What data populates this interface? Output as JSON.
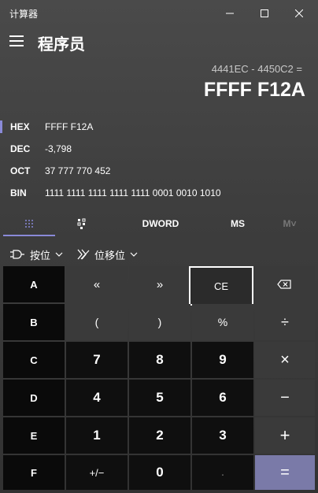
{
  "window": {
    "title": "计算器"
  },
  "header": {
    "mode_title": "程序员"
  },
  "display": {
    "expression": "4441EC - 4450C2 =",
    "result": "FFFF F12A"
  },
  "bases": [
    {
      "label": "HEX",
      "value": "FFFF F12A",
      "selected": true
    },
    {
      "label": "DEC",
      "value": "-3,798"
    },
    {
      "label": "OCT",
      "value": "37 777 770 452"
    },
    {
      "label": "BIN",
      "value": "1111 1111 1111 1111 1111 0001 0010 1010"
    }
  ],
  "tabs": {
    "word_size": "DWORD",
    "memory_store": "MS",
    "memory_recall": "M˅"
  },
  "ops": {
    "bitwise": "按位",
    "bitshift": "位移位"
  },
  "keys": {
    "row1": [
      "A",
      "«",
      "»",
      "CE",
      "⌫"
    ],
    "row2": [
      "B",
      "(",
      ")",
      "%",
      "÷"
    ],
    "row3": [
      "C",
      "7",
      "8",
      "9",
      "×"
    ],
    "row4": [
      "D",
      "4",
      "5",
      "6",
      "−"
    ],
    "row5": [
      "E",
      "1",
      "2",
      "3",
      "+"
    ],
    "row6": [
      "F",
      "+/−",
      "0",
      ".",
      "="
    ]
  },
  "colors": {
    "accent": "#8a8ad8",
    "equals_bg": "#7a7aa8",
    "key_dark": "#0f0f0f",
    "key_mid": "#3a3a3a"
  }
}
